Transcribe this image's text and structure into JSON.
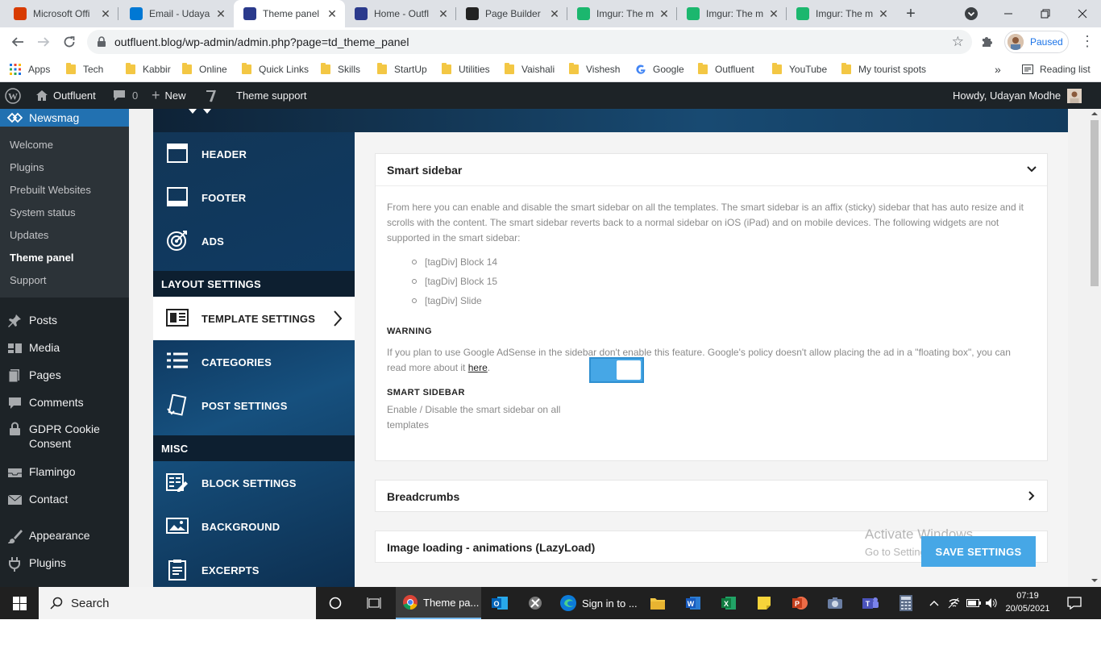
{
  "browser": {
    "tabs": [
      {
        "title": "Microsoft Offi",
        "icon": "office-icon",
        "color": "#d83b01"
      },
      {
        "title": "Email - Udaya",
        "icon": "outlook-icon",
        "color": "#0078d4"
      },
      {
        "title": "Theme panel",
        "icon": "newsmag-icon",
        "color": "#2b3a8c"
      },
      {
        "title": "Home - Outfl",
        "icon": "newsmag-icon",
        "color": "#2b3a8c"
      },
      {
        "title": "Page Builder",
        "icon": "tagdiv-icon",
        "color": "#222222"
      },
      {
        "title": "Imgur: The m",
        "icon": "imgur-icon",
        "color": "#1bb76e"
      },
      {
        "title": "Imgur: The m",
        "icon": "imgur-icon",
        "color": "#1bb76e"
      },
      {
        "title": "Imgur: The m",
        "icon": "imgur-icon",
        "color": "#1bb76e"
      }
    ],
    "url": "outfluent.blog/wp-admin/admin.php?page=td_theme_panel",
    "profile_status": "Paused",
    "bookmarks": [
      {
        "label": "Apps",
        "type": "apps"
      },
      {
        "label": "Tech",
        "type": "folder"
      },
      {
        "label": "Kabbir",
        "type": "folder"
      },
      {
        "label": "Online",
        "type": "folder"
      },
      {
        "label": "Quick Links",
        "type": "folder"
      },
      {
        "label": "Skills",
        "type": "folder"
      },
      {
        "label": "StartUp",
        "type": "folder"
      },
      {
        "label": "Utilities",
        "type": "folder"
      },
      {
        "label": "Vaishali",
        "type": "folder"
      },
      {
        "label": "Vishesh",
        "type": "folder"
      },
      {
        "label": "Google",
        "type": "google"
      },
      {
        "label": "Outfluent",
        "type": "folder"
      },
      {
        "label": "YouTube",
        "type": "folder"
      },
      {
        "label": "My tourist spots",
        "type": "folder"
      }
    ],
    "reading_list": "Reading list",
    "more_bookmarks": "»"
  },
  "adminbar": {
    "site": "Outfluent",
    "comments": "0",
    "new": "New",
    "theme_support": "Theme support",
    "howdy": "Howdy, Udayan Modhe"
  },
  "wp_sidebar": {
    "current": "Newsmag",
    "submenu": [
      "Welcome",
      "Plugins",
      "Prebuilt Websites",
      "System status",
      "Updates",
      "Theme panel",
      "Support"
    ],
    "menu": [
      {
        "label": "Posts",
        "icon": "pin-icon"
      },
      {
        "label": "Media",
        "icon": "media-icon"
      },
      {
        "label": "Pages",
        "icon": "pages-icon"
      },
      {
        "label": "Comments",
        "icon": "comment-icon"
      },
      {
        "label": "GDPR Cookie Consent",
        "icon": "lock-icon"
      },
      {
        "label": "Flamingo",
        "icon": "inbox-icon"
      },
      {
        "label": "Contact",
        "icon": "mail-icon"
      },
      {
        "label": "Appearance",
        "icon": "brush-icon"
      },
      {
        "label": "Plugins",
        "icon": "plug-icon"
      }
    ]
  },
  "theme_menu": {
    "items_top": [
      "HEADER",
      "FOOTER",
      "ADS"
    ],
    "section_layout": "LAYOUT SETTINGS",
    "items_layout": [
      "TEMPLATE SETTINGS",
      "CATEGORIES",
      "POST SETTINGS"
    ],
    "section_misc": "MISC",
    "items_misc": [
      "BLOCK SETTINGS",
      "BACKGROUND",
      "EXCERPTS"
    ]
  },
  "smart_sidebar": {
    "title": "Smart sidebar",
    "description": "From here you can enable and disable the smart sidebar on all the templates. The smart sidebar is an affix (sticky) sidebar that has auto resize and it scrolls with the content. The smart sidebar reverts back to a normal sidebar on iOS (iPad) and on mobile devices. The following widgets are not supported in the smart sidebar:",
    "unsupported": [
      "[tagDiv] Block 14",
      "[tagDiv] Block 15",
      "[tagDiv] Slide"
    ],
    "warning_label": "WARNING",
    "warning_text": "If you plan to use Google AdSense in the sidebar don't enable this feature. Google's policy doesn't allow placing the ad in a \"floating box\", you can read more about it",
    "warning_link": "here",
    "warning_end": ".",
    "setting_label": "SMART SIDEBAR",
    "setting_desc": "Enable / Disable the smart sidebar on all templates",
    "enabled": true
  },
  "sections": {
    "breadcrumbs": "Breadcrumbs",
    "lazyload": "Image loading - animations (LazyLoad)"
  },
  "save_button": "SAVE SETTINGS",
  "watermark": {
    "line1": "Activate Windows",
    "line2": "Go to Settings to activate Windows."
  },
  "taskbar": {
    "search": "Search",
    "chrome_label": "Theme pa...",
    "edge_label": "Sign in to ...",
    "time": "07:19",
    "date": "20/05/2021"
  }
}
